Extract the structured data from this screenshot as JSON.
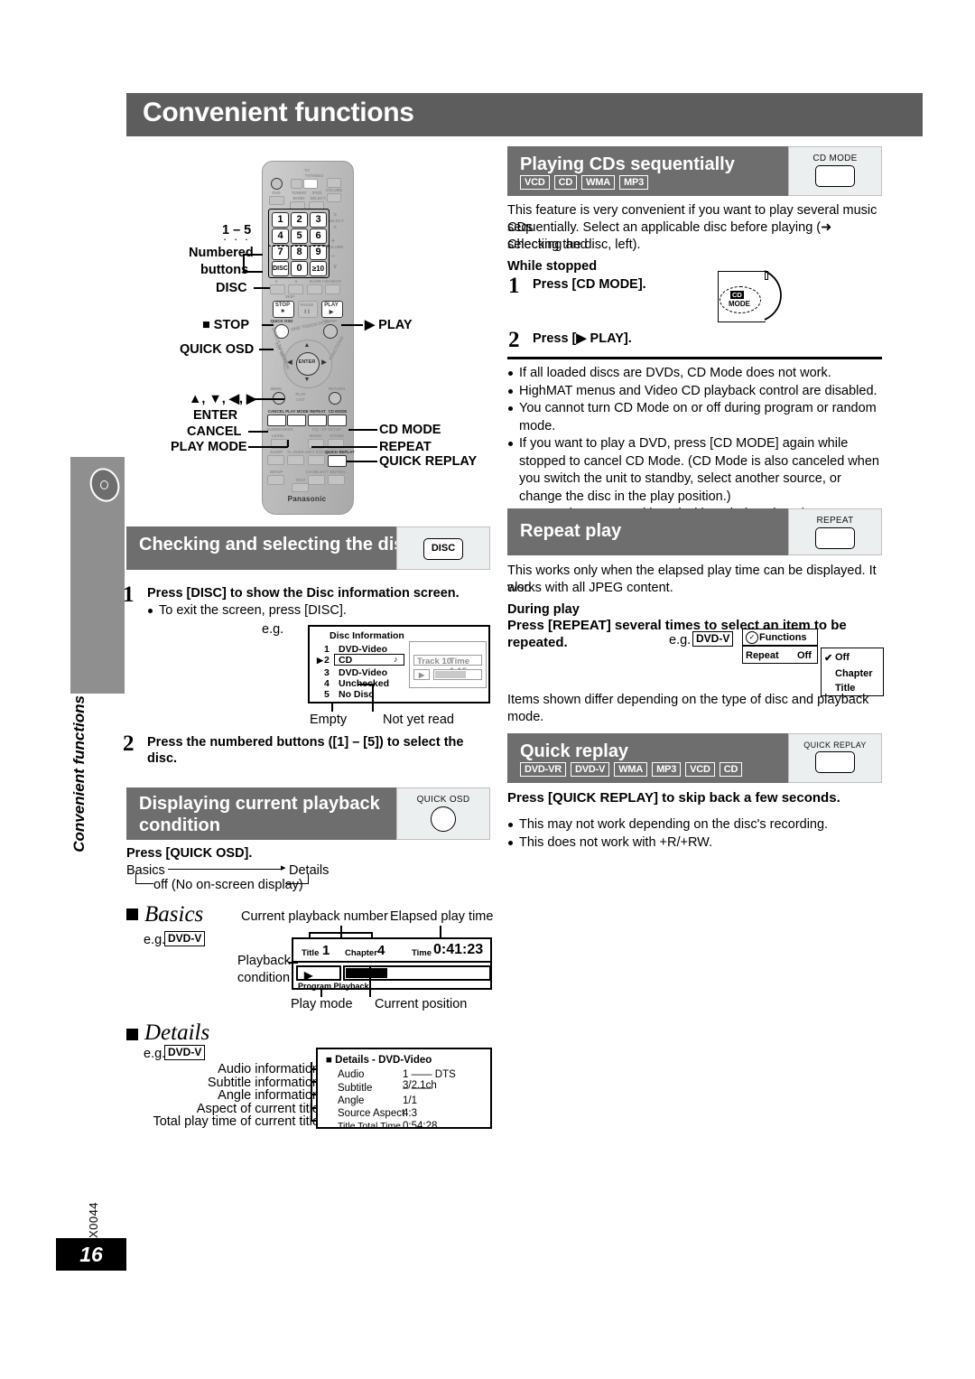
{
  "page": {
    "title": "Convenient functions",
    "side_label": "Convenient functions",
    "part_number": "RQTX0044",
    "page_number": "16"
  },
  "remote": {
    "brand": "Panasonic",
    "callouts": {
      "range_1_5": "1 – 5",
      "numbered_buttons_l1": "Numbered",
      "numbered_buttons_l2": "buttons",
      "disc": "DISC",
      "stop": "■ STOP",
      "play": "▶ PLAY",
      "quick_osd": "QUICK OSD",
      "cursor": "▲, ▼, ◀, ▶",
      "enter": "ENTER",
      "cancel": "CANCEL",
      "play_mode": "PLAY MODE",
      "cd_mode": "CD MODE",
      "repeat": "REPEAT",
      "quick_replay": "QUICK REPLAY"
    },
    "keypad": [
      "1",
      "2",
      "3",
      "4",
      "5",
      "6",
      "7",
      "8",
      "9",
      "DISC",
      "0",
      "≥10"
    ],
    "top_labels": {
      "tv": "TV",
      "tv_video": "TV/VIDEO",
      "volume": "VOLUME",
      "dvd": "DVD",
      "tuner": "TUNER/",
      "band": "BAND",
      "ipod": "IPOD",
      "select": "SELECT"
    },
    "mid_labels": {
      "skip": "SKIP",
      "slow_search": "SLOW / SEARCH",
      "pause": "PAUSE",
      "group": "GROUP",
      "one_touch_play": "ONE TOUCH PLAY",
      "top_menu": "TOP MENU",
      "direct_navigator": "DIRECT NAVIGATOR",
      "functions": "FUNCTIONS",
      "menu": "MENU",
      "return": "RETURN",
      "play_list": "PLAY LIST",
      "enter": "ENTER"
    },
    "bottom_labels": {
      "cancel": "CANCEL",
      "play_mode": "PLAY MODE",
      "repeat": "REPEAT",
      "cd_mode": "CD MODE",
      "subwoofer": "SUBWOOFER",
      "level": "LEVEL",
      "music": "MUSIC",
      "sound": "SOUND",
      "sleep": "SLEEP",
      "fl_display": "FL DISPLAY",
      "ct_focus": "CT FOCUS",
      "quick_replay": "QUICK REPLAY",
      "setup": "SETUP",
      "ch_select": "CH SELECT",
      "muting": "MUTING",
      "test": "TEST"
    }
  },
  "sections": {
    "checking_disc": {
      "heading": "Checking and selecting the disc",
      "button_label": "DISC",
      "button_shape": "rect-text",
      "step1_num": "1",
      "step1_text": "Press [DISC] to show the Disc information screen.",
      "step1_bullet": "To exit the screen, press [DISC].",
      "eg": "e.g.",
      "step2_num": "2",
      "step2_text_l1": "Press the numbered buttons ([1] – [5]) to select the",
      "step2_text_l2": "disc.",
      "osd": {
        "title": "Disc Information",
        "rows": [
          {
            "num": "1",
            "label": "DVD-Video",
            "selected": false
          },
          {
            "num": "2",
            "label": "CD",
            "selected": true
          },
          {
            "num": "3",
            "label": "DVD-Video",
            "selected": false
          },
          {
            "num": "4",
            "label": "Unchecked",
            "selected": false
          },
          {
            "num": "5",
            "label": "No Disc",
            "selected": false
          }
        ],
        "track": "Track 10",
        "time": "Time 1:15",
        "note_empty": "Empty",
        "note_notread": "Not yet read"
      }
    },
    "displaying_playback": {
      "heading_l1": "Displaying current playback",
      "heading_l2": "condition",
      "button_label": "QUICK OSD",
      "button_shape": "round",
      "press_line": "Press [QUICK OSD].",
      "flow_basics": "Basics",
      "flow_details": "Details",
      "flow_off": "off (No on-screen display)",
      "basics": {
        "title": "Basics",
        "eg": "e.g.",
        "eg_badge": "DVD-V",
        "callout_number": "Current playback number",
        "callout_elapsed": "Elapsed play time",
        "callout_playback_l1": "Playback",
        "callout_playback_l2": "condition",
        "callout_playmode": "Play mode",
        "callout_position": "Current position",
        "osd": {
          "title_label": "Title",
          "title_value": "1",
          "chapter_label": "Chapter",
          "chapter_value": "4",
          "time_label": "Time",
          "time_value": "0:41:23",
          "play_mode_text": "Program Playback"
        }
      },
      "details": {
        "title": "Details",
        "eg": "e.g.",
        "eg_badge": "DVD-V",
        "callouts": [
          "Audio information",
          "Subtitle information",
          "Angle information",
          "Aspect of current title",
          "Total play time of current title"
        ],
        "osd": {
          "title": "■ Details - DVD-Video",
          "rows": [
            {
              "key": "Audio",
              "value": "1  —— DTS 3/2.1ch"
            },
            {
              "key": "Subtitle",
              "value": "–  ——"
            },
            {
              "key": "Angle",
              "value": "1/1"
            },
            {
              "key": "Source Aspect",
              "value": "4:3"
            },
            {
              "key": "Title Total Time",
              "value": "0:54:28"
            }
          ]
        }
      }
    },
    "playing_cds": {
      "heading": "Playing CDs sequentially",
      "badges": [
        "VCD",
        "CD",
        "WMA",
        "MP3"
      ],
      "button_label": "CD MODE",
      "button_shape": "rect",
      "intro_l1": "This feature is very convenient if you want to play several music CDs",
      "intro_l2": "sequentially. Select an applicable disc before playing (➜ Checking and",
      "intro_l3": "selecting the disc, left).",
      "condition": "While stopped",
      "step1_num": "1",
      "step1_text": "Press [CD MODE].",
      "step2_num": "2",
      "step2_text": "Press [▶ PLAY].",
      "unit_cd": "CD",
      "unit_mode": "MODE",
      "notes": [
        "If all loaded discs are DVDs, CD Mode does not work.",
        "HighMAT menus and Video CD playback control are disabled.",
        "You cannot turn CD Mode on or off during program or random mode.",
        "If you want to play a DVD, press [CD MODE] again while stopped to cancel CD Mode. (CD Mode is also canceled when you switch the unit to standby, select another source, or change the disc in the play position.)",
        "DVD and JPEG are skipped without being played."
      ]
    },
    "repeat_play": {
      "heading": "Repeat play",
      "button_label": "REPEAT",
      "button_shape": "rect",
      "intro_l1": "This works only when the elapsed play time can be displayed. It also",
      "intro_l2": "works with all JPEG content.",
      "condition": "During play",
      "instruction": "Press [REPEAT] several times to select an item to be repeated.",
      "eg": "e.g.",
      "eg_badge": "DVD-V",
      "osd": {
        "header": "Functions",
        "row_key": "Repeat",
        "row_value": "Off",
        "options": [
          "Off",
          "Chapter",
          "Title"
        ],
        "checked_option": "Off"
      },
      "footnote": "Items shown differ depending on the type of disc and playback mode."
    },
    "quick_replay": {
      "heading": "Quick replay",
      "badges": [
        "DVD-VR",
        "DVD-V",
        "WMA",
        "MP3",
        "VCD",
        "CD"
      ],
      "button_label": "QUICK REPLAY",
      "button_shape": "rect",
      "instruction": "Press [QUICK REPLAY] to skip back a few seconds.",
      "notes": [
        "This may not work depending on the disc's recording.",
        "This does not work with +R/+RW."
      ]
    }
  }
}
